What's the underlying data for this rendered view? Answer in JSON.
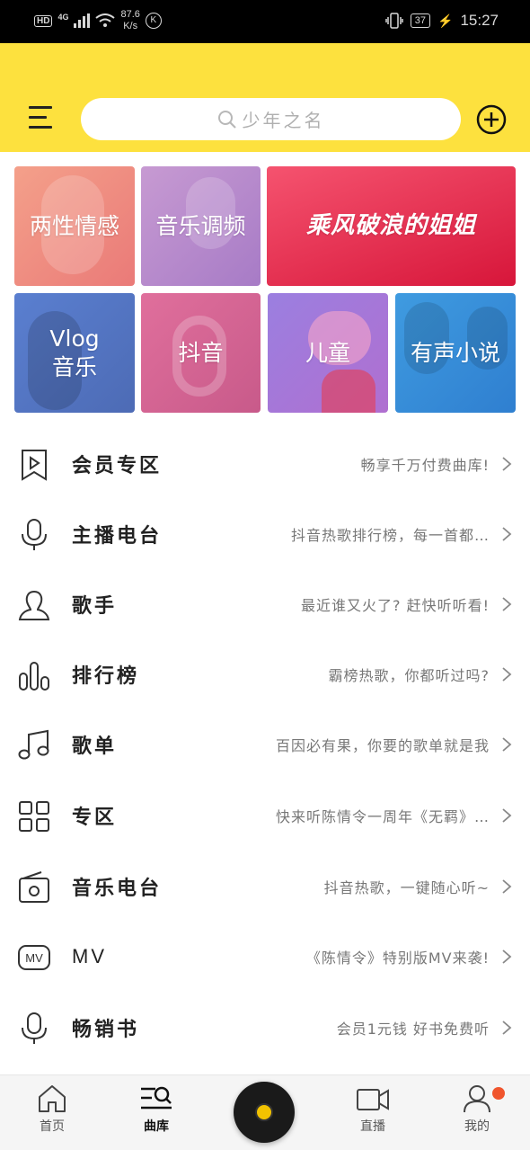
{
  "status_bar": {
    "hd": "HD",
    "network": "4G",
    "speed_value": "87.6",
    "speed_unit": "K/s",
    "k_icon": "K",
    "battery": "37",
    "time": "15:27"
  },
  "header": {
    "search_placeholder": "少年之名"
  },
  "categories": {
    "t1": "两性情感",
    "t2": "音乐调频",
    "t3": "乘风破浪的姐姐",
    "t4_line1": "Vlog",
    "t4_line2": "音乐",
    "t5": "抖音",
    "t6": "儿童",
    "t7": "有声小说"
  },
  "menu": [
    {
      "title": "会员专区",
      "subtitle": "畅享千万付费曲库!",
      "icon": "bookmark-play-icon"
    },
    {
      "title": "主播电台",
      "subtitle": "抖音热歌排行榜，每一首都…",
      "icon": "microphone-icon"
    },
    {
      "title": "歌手",
      "subtitle": "最近谁又火了? 赶快听听看!",
      "icon": "person-icon"
    },
    {
      "title": "排行榜",
      "subtitle": "霸榜热歌，你都听过吗?",
      "icon": "chart-bars-icon"
    },
    {
      "title": "歌单",
      "subtitle": "百因必有果，你要的歌单就是我",
      "icon": "music-note-icon"
    },
    {
      "title": "专区",
      "subtitle": "快来听陈情令一周年《无羁》…",
      "icon": "grid-icon"
    },
    {
      "title": "音乐电台",
      "subtitle": "抖音热歌，一键随心听~",
      "icon": "radio-icon"
    },
    {
      "title": "MV",
      "subtitle": "《陈情令》特别版MV来袭!",
      "icon": "mv-icon"
    },
    {
      "title": "畅销书",
      "subtitle": "会员1元钱 好书免费听",
      "icon": "microphone-icon"
    }
  ],
  "tabbar": {
    "home": "首页",
    "library": "曲库",
    "live": "直播",
    "mine": "我的"
  },
  "colors": {
    "header_bg": "#fde13e",
    "badge": "#f0552d",
    "player_disc": "#f2c200"
  }
}
